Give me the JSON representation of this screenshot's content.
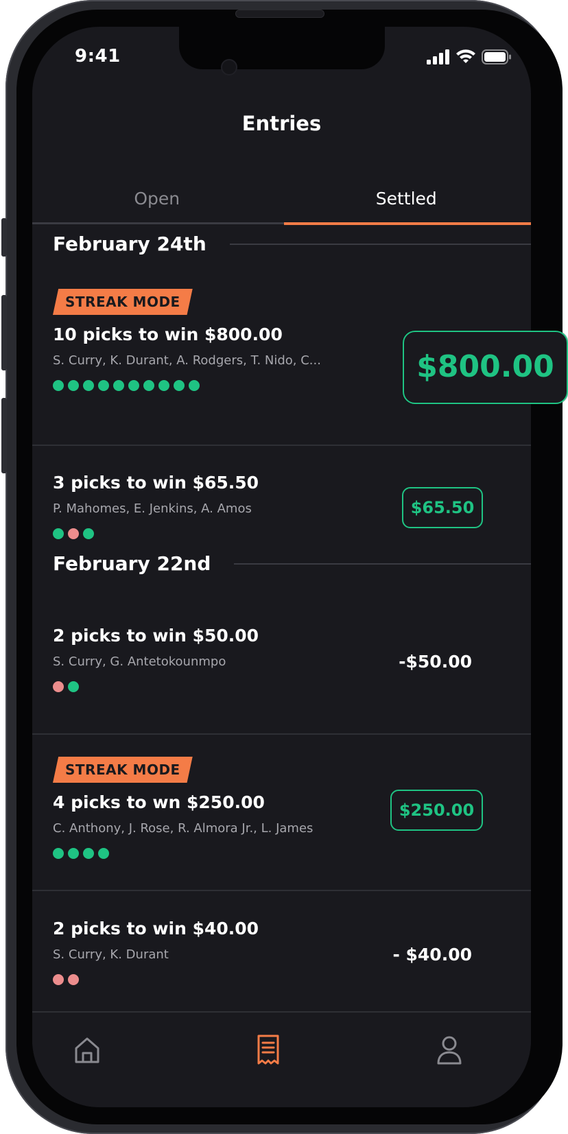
{
  "status_bar": {
    "time": "9:41"
  },
  "header": {
    "title": "Entries"
  },
  "tabs": [
    {
      "label": "Open",
      "active": false
    },
    {
      "label": "Settled",
      "active": true
    }
  ],
  "colors": {
    "accent": "#f47c47",
    "win": "#1fc383",
    "loss": "#ec8d8d",
    "background": "#19191e"
  },
  "sections": [
    {
      "date": "February 24th",
      "entries": [
        {
          "badge": "STREAK MODE",
          "title": "10 picks to win $800.00",
          "players": "S. Curry, K. Durant, A. Rodgers, T. Nido, C...",
          "results": [
            "win",
            "win",
            "win",
            "win",
            "win",
            "win",
            "win",
            "win",
            "win",
            "win"
          ],
          "payout": "$800.00"
        },
        {
          "badge": "",
          "title": "3 picks to win $65.50",
          "players": "P. Mahomes, E. Jenkins, A. Amos",
          "results": [
            "win",
            "loss",
            "win"
          ],
          "payout": "$65.50"
        }
      ]
    },
    {
      "date": "February 22nd",
      "entries": [
        {
          "badge": "",
          "title": "2 picks to win $50.00",
          "players": "S. Curry, G. Antetokounmpo",
          "results": [
            "loss",
            "win"
          ],
          "amount": "-$50.00"
        },
        {
          "badge": "STREAK MODE",
          "title": "4 picks to wn $250.00",
          "players": "C. Anthony, J. Rose, R. Almora Jr., L. James",
          "results": [
            "win",
            "win",
            "win",
            "win"
          ],
          "payout": "$250.00"
        },
        {
          "badge": "",
          "title": "2 picks to win $40.00",
          "players": "S. Curry, K. Durant",
          "results": [
            "loss",
            "loss"
          ],
          "amount": "- $40.00"
        }
      ]
    }
  ],
  "bottom_nav": [
    {
      "icon": "home-icon",
      "active": false
    },
    {
      "icon": "receipt-icon",
      "active": true
    },
    {
      "icon": "profile-icon",
      "active": false
    }
  ]
}
